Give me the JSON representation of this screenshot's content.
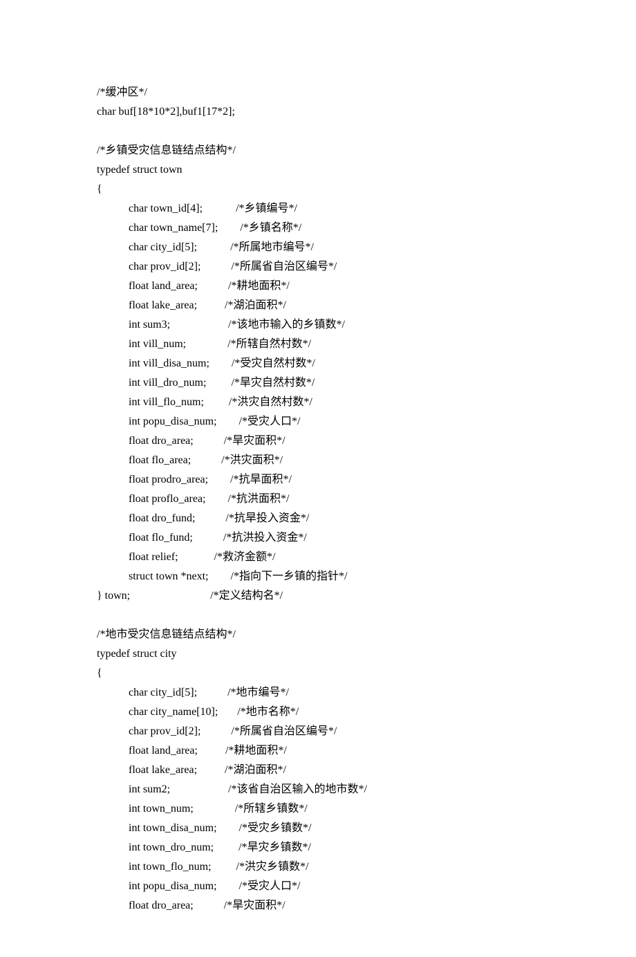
{
  "lines": [
    {
      "indent": 0,
      "text": "/*缓冲区*/"
    },
    {
      "indent": 0,
      "text": "char buf[18*10*2],buf1[17*2];"
    },
    {
      "indent": 0,
      "text": ""
    },
    {
      "indent": 0,
      "text": "/*乡镇受灾信息链结点结构*/"
    },
    {
      "indent": 0,
      "text": "typedef struct town"
    },
    {
      "indent": 0,
      "text": "{"
    },
    {
      "indent": 1,
      "text": "char town_id[4];            /*乡镇编号*/"
    },
    {
      "indent": 1,
      "text": "char town_name[7];        /*乡镇名称*/"
    },
    {
      "indent": 1,
      "text": "char city_id[5];            /*所属地市编号*/"
    },
    {
      "indent": 1,
      "text": "char prov_id[2];           /*所属省自治区编号*/"
    },
    {
      "indent": 1,
      "text": "float land_area;           /*耕地面积*/"
    },
    {
      "indent": 1,
      "text": "float lake_area;          /*湖泊面积*/"
    },
    {
      "indent": 1,
      "text": "int sum3;                     /*该地市输入的乡镇数*/"
    },
    {
      "indent": 1,
      "text": "int vill_num;               /*所辖自然村数*/"
    },
    {
      "indent": 1,
      "text": "int vill_disa_num;        /*受灾自然村数*/"
    },
    {
      "indent": 1,
      "text": "int vill_dro_num;         /*旱灾自然村数*/"
    },
    {
      "indent": 1,
      "text": "int vill_flo_num;         /*洪灾自然村数*/"
    },
    {
      "indent": 1,
      "text": "int popu_disa_num;        /*受灾人口*/"
    },
    {
      "indent": 1,
      "text": "float dro_area;           /*旱灾面积*/"
    },
    {
      "indent": 1,
      "text": "float flo_area;           /*洪灾面积*/"
    },
    {
      "indent": 1,
      "text": "float prodro_area;        /*抗旱面积*/"
    },
    {
      "indent": 1,
      "text": "float proflo_area;        /*抗洪面积*/"
    },
    {
      "indent": 1,
      "text": "float dro_fund;           /*抗旱投入资金*/"
    },
    {
      "indent": 1,
      "text": "float flo_fund;           /*抗洪投入资金*/"
    },
    {
      "indent": 1,
      "text": "float relief;             /*救济金额*/"
    },
    {
      "indent": 1,
      "text": "struct town *next;        /*指向下一乡镇的指针*/"
    },
    {
      "indent": 0,
      "text": "} town;                             /*定义结构名*/"
    },
    {
      "indent": 0,
      "text": ""
    },
    {
      "indent": 0,
      "text": "/*地市受灾信息链结点结构*/"
    },
    {
      "indent": 0,
      "text": "typedef struct city"
    },
    {
      "indent": 0,
      "text": "{"
    },
    {
      "indent": 1,
      "text": "char city_id[5];           /*地市编号*/"
    },
    {
      "indent": 1,
      "text": "char city_name[10];       /*地市名称*/"
    },
    {
      "indent": 1,
      "text": "char prov_id[2];           /*所属省自治区编号*/"
    },
    {
      "indent": 1,
      "text": "float land_area;          /*耕地面积*/"
    },
    {
      "indent": 1,
      "text": "float lake_area;          /*湖泊面积*/"
    },
    {
      "indent": 1,
      "text": "int sum2;                     /*该省自治区输入的地市数*/"
    },
    {
      "indent": 1,
      "text": "int town_num;               /*所辖乡镇数*/"
    },
    {
      "indent": 1,
      "text": "int town_disa_num;        /*受灾乡镇数*/"
    },
    {
      "indent": 1,
      "text": "int town_dro_num;         /*旱灾乡镇数*/"
    },
    {
      "indent": 1,
      "text": "int town_flo_num;         /*洪灾乡镇数*/"
    },
    {
      "indent": 1,
      "text": "int popu_disa_num;        /*受灾人口*/"
    },
    {
      "indent": 1,
      "text": "float dro_area;           /*旱灾面积*/"
    }
  ]
}
